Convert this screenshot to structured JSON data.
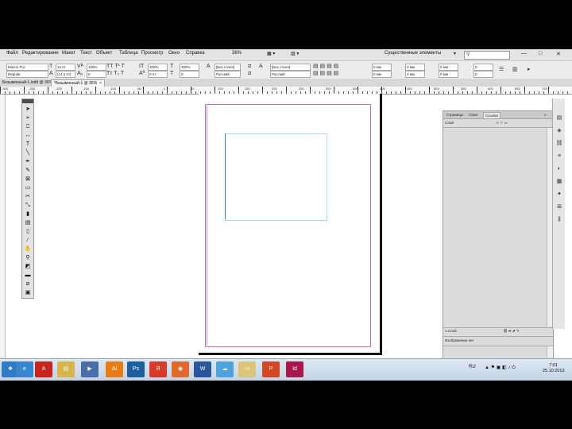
{
  "menu": {
    "items": [
      "Файл",
      "Редактирование",
      "Макет",
      "Текст",
      "Объект",
      "Таблица",
      "Просмотр",
      "Окно",
      "Справка"
    ],
    "zoom": "36%",
    "workspace": "Существенные элементы",
    "win_min": "—",
    "win_max": "□",
    "win_close": "✕"
  },
  "control": {
    "font_family": "Minion Pro",
    "font_style": "Regular",
    "font_size": "12 пт",
    "leading": "(14,4 пт)",
    "tracking": "100%",
    "kerning": "0",
    "scale": "100%",
    "baseline": "0 пт",
    "char_style": "[Без стиля]",
    "lang": "Русский",
    "indent1": "0 мм",
    "indent2": "0 мм",
    "indent3": "0 мм",
    "indent4": "0 мм",
    "space1": "0 мм",
    "space2": "0 мм",
    "space3": "0",
    "space4": "0",
    "cols": "0 мм"
  },
  "tabs": [
    {
      "label": "Безымянный-1.indd @ 36%",
      "close": "×"
    },
    {
      "label": "*Безымянный-1 @ 36%",
      "close": "×"
    }
  ],
  "ruler": {
    "numbers": [
      "-300",
      "-250",
      "-200",
      "-150",
      "-100",
      "-50",
      "0",
      "50",
      "100",
      "150",
      "200",
      "250",
      "300",
      "350",
      "400",
      "450",
      "500",
      "550",
      "600",
      "650",
      "700"
    ]
  },
  "tools": [
    {
      "name": "selection-tool",
      "glyph": "➤"
    },
    {
      "name": "direct-selection-tool",
      "glyph": "➢"
    },
    {
      "name": "page-tool",
      "glyph": "⎕"
    },
    {
      "name": "gap-tool",
      "glyph": "↔"
    },
    {
      "name": "type-tool",
      "glyph": "T"
    },
    {
      "name": "line-tool",
      "glyph": "╲"
    },
    {
      "name": "pen-tool",
      "glyph": "✒"
    },
    {
      "name": "pencil-tool",
      "glyph": "✎"
    },
    {
      "name": "rectangle-frame-tool",
      "glyph": "⊠"
    },
    {
      "name": "rectangle-tool",
      "glyph": "▭"
    },
    {
      "name": "scissors-tool",
      "glyph": "✂"
    },
    {
      "name": "free-transform-tool",
      "glyph": "⤡"
    },
    {
      "name": "gradient-swatch-tool",
      "glyph": "▮"
    },
    {
      "name": "gradient-feather-tool",
      "glyph": "▤"
    },
    {
      "name": "note-tool",
      "glyph": "▯"
    },
    {
      "name": "eyedropper-tool",
      "glyph": "⁄"
    },
    {
      "name": "hand-tool",
      "glyph": "✋"
    },
    {
      "name": "zoom-tool",
      "glyph": "⚲"
    },
    {
      "name": "fill-stroke-swatch",
      "glyph": "◩"
    },
    {
      "name": "apply-color",
      "glyph": "▬"
    },
    {
      "name": "apply-none",
      "glyph": "⧄"
    },
    {
      "name": "screen-mode",
      "glyph": "▣"
    }
  ],
  "panel": {
    "tabs": [
      "Страницы",
      "Слои",
      "Ссылки"
    ],
    "layer_row": "Слой",
    "status_text": "1 Слой",
    "bottom_title": "Изображение нет"
  },
  "dock_icons": [
    "pages-icon",
    "layers-icon",
    "links-icon",
    "stroke-icon",
    "color-icon",
    "swatches-icon",
    "effects-icon",
    "text-wrap-icon",
    "align-icon"
  ],
  "taskbar": {
    "apps": [
      {
        "name": "start-button",
        "glyph": "❖",
        "color": "#2e7bc6"
      },
      {
        "name": "ie-icon",
        "glyph": "e",
        "color": "#3a85cf"
      },
      {
        "name": "acrobat-icon",
        "glyph": "A",
        "color": "#c8231c"
      },
      {
        "name": "explorer-icon",
        "glyph": "▤",
        "color": "#d9b44a"
      },
      {
        "name": "media-player-icon",
        "glyph": "▶",
        "color": "#4a6fa6"
      },
      {
        "name": "illustrator-icon",
        "glyph": "Ai",
        "color": "#e77c14"
      },
      {
        "name": "photoshop-icon",
        "glyph": "Ps",
        "color": "#1c5f9b"
      },
      {
        "name": "yandex-icon",
        "glyph": "Я",
        "color": "#d93b2b"
      },
      {
        "name": "firefox-icon",
        "glyph": "◉",
        "color": "#e1692a"
      },
      {
        "name": "word-icon",
        "glyph": "W",
        "color": "#2b579a"
      },
      {
        "name": "skype-icon",
        "glyph": "☁",
        "color": "#4ea3dd"
      },
      {
        "name": "folder-icon",
        "glyph": "▭",
        "color": "#d9c57a"
      },
      {
        "name": "powerpoint-icon",
        "glyph": "P",
        "color": "#d24726"
      },
      {
        "name": "indesign-icon",
        "glyph": "Id",
        "color": "#a8164b"
      }
    ],
    "lang": "RU",
    "time": "7:01",
    "date": "25.10.2013"
  }
}
